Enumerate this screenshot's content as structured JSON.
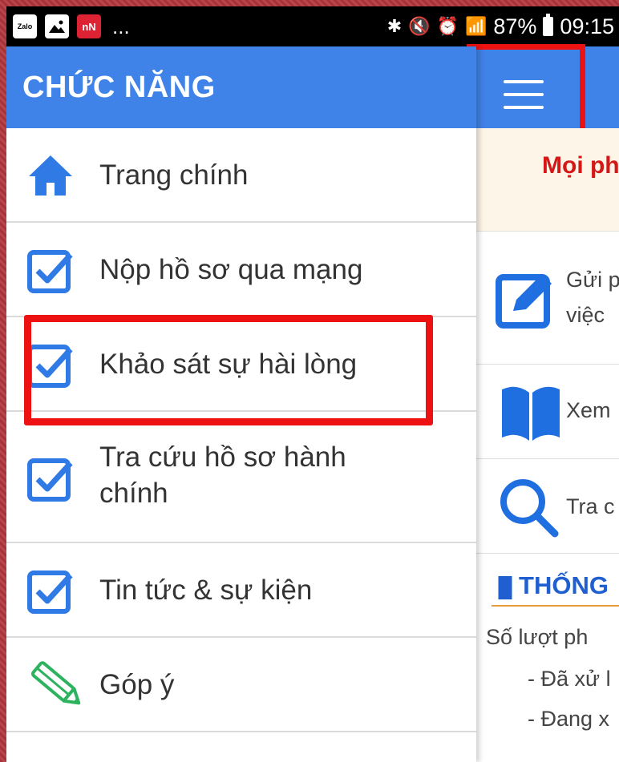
{
  "status_bar": {
    "apps": [
      "Zalo",
      "photo",
      "nN"
    ],
    "more": "...",
    "battery": "87%",
    "time": "09:15"
  },
  "drawer": {
    "title": "CHỨC NĂNG",
    "items": [
      {
        "label": "Trang chính",
        "icon": "home-icon"
      },
      {
        "label": "Nộp hồ sơ qua mạng",
        "icon": "checkbox-icon"
      },
      {
        "label": "Khảo sát sự hài lòng",
        "icon": "checkbox-icon"
      },
      {
        "label": "Tra cứu hồ sơ hành chính",
        "icon": "checkbox-icon"
      },
      {
        "label": "Tin tức & sự kiện",
        "icon": "checkbox-icon"
      },
      {
        "label": "Góp ý",
        "icon": "pencil-icon"
      }
    ]
  },
  "background": {
    "notice": "Mọi ph",
    "rows": [
      {
        "line1": "Gửi p",
        "line2": "việc",
        "icon": "edit-icon"
      },
      {
        "line1": "Xem",
        "icon": "book-icon"
      },
      {
        "line1": "Tra c",
        "icon": "search-icon"
      }
    ],
    "stats_title": "THỐNG",
    "stats_lines": [
      "Số lượt ph",
      "- Đã xử l",
      "- Đang x"
    ]
  },
  "colors": {
    "primary": "#3f82e8",
    "highlight": "#ee1111",
    "notice": "#d41818"
  }
}
